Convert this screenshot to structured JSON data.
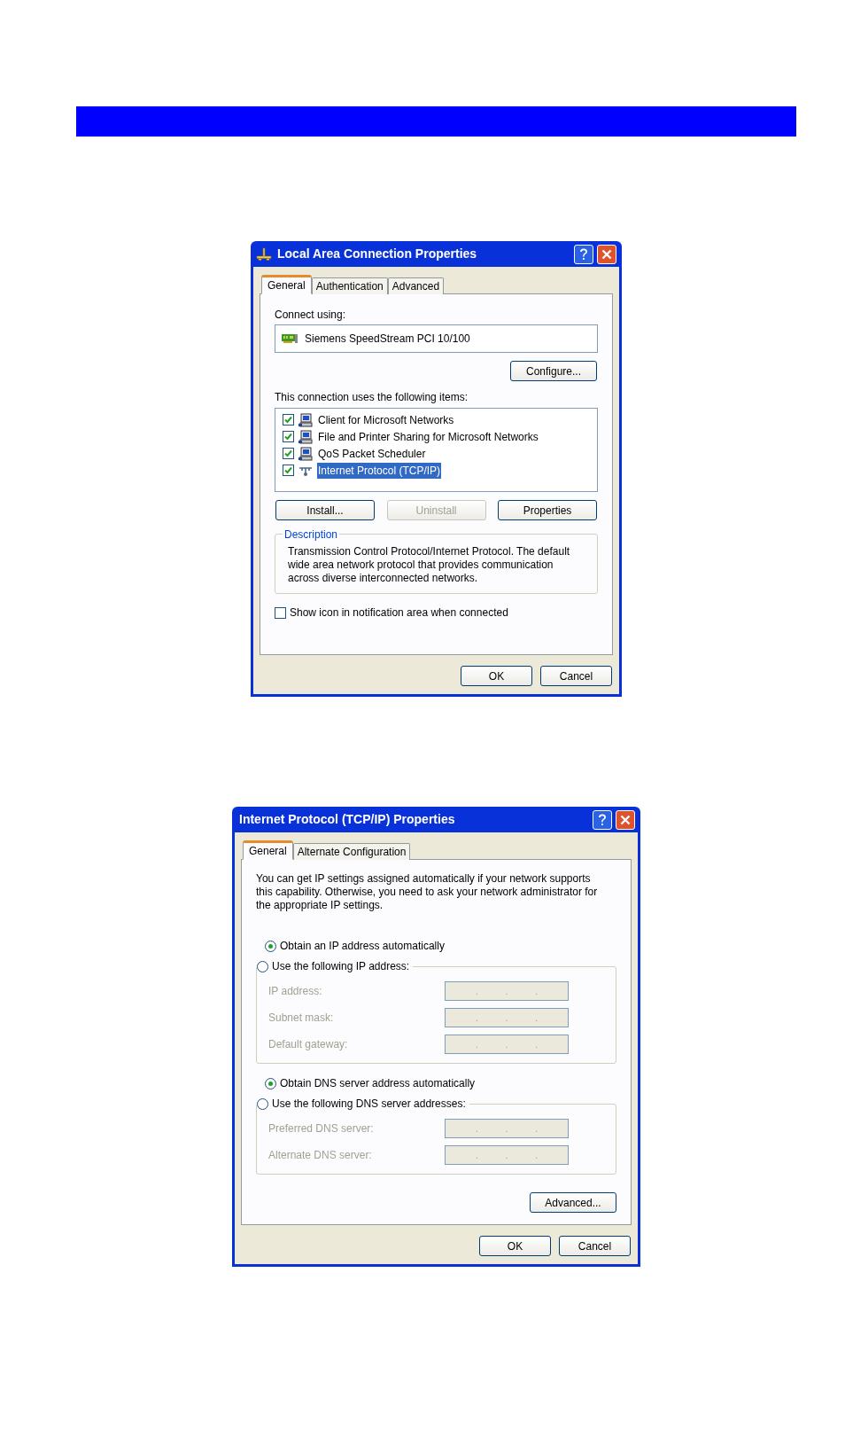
{
  "dialog_1": {
    "title": "Local Area Connection Properties",
    "tabs": [
      {
        "label": "General",
        "selected": true
      },
      {
        "label": "Authentication",
        "selected": false
      },
      {
        "label": "Advanced",
        "selected": false
      }
    ],
    "connect_using_label": "Connect using:",
    "adapter": "Siemens SpeedStream PCI 10/100",
    "configure_button": "Configure...",
    "items_label": "This connection uses the following items:",
    "items": [
      {
        "label": "Client for Microsoft Networks",
        "checked": true,
        "selected": false,
        "kind": "computer"
      },
      {
        "label": "File and Printer Sharing for Microsoft Networks",
        "checked": true,
        "selected": false,
        "kind": "computer"
      },
      {
        "label": "QoS Packet Scheduler",
        "checked": true,
        "selected": false,
        "kind": "computer"
      },
      {
        "label": "Internet Protocol (TCP/IP)",
        "checked": true,
        "selected": true,
        "kind": "protocol"
      }
    ],
    "item_buttons": [
      {
        "label": "Install...",
        "disabled": false
      },
      {
        "label": "Uninstall",
        "disabled": true
      },
      {
        "label": "Properties",
        "disabled": false
      }
    ],
    "description": {
      "legend": "Description",
      "text": "Transmission Control Protocol/Internet Protocol. The default wide area network protocol that provides communication across diverse interconnected networks."
    },
    "show_icon": {
      "label": "Show icon in notification area when connected",
      "checked": false
    },
    "footer_buttons": [
      "OK",
      "Cancel"
    ]
  },
  "dialog_2": {
    "title": "Internet Protocol (TCP/IP) Properties",
    "tabs": [
      {
        "label": "General",
        "selected": true
      },
      {
        "label": "Alternate Configuration",
        "selected": false
      }
    ],
    "intro": "You can get IP settings assigned automatically if your network supports this capability. Otherwise, you need to ask your network administrator for the appropriate IP settings.",
    "ip_options": [
      {
        "label": "Obtain an IP address automatically",
        "selected": true
      },
      {
        "label": "Use the following IP address:",
        "selected": false
      }
    ],
    "ip_fields": [
      {
        "label": "IP address:",
        "value": ". . .",
        "disabled": true
      },
      {
        "label": "Subnet mask:",
        "value": ". . .",
        "disabled": true
      },
      {
        "label": "Default gateway:",
        "value": ". . .",
        "disabled": true
      }
    ],
    "dns_options": [
      {
        "label": "Obtain DNS server address automatically",
        "selected": true
      },
      {
        "label": "Use the following DNS server addresses:",
        "selected": false
      }
    ],
    "dns_fields": [
      {
        "label": "Preferred DNS server:",
        "value": ". . .",
        "disabled": true
      },
      {
        "label": "Alternate DNS server:",
        "value": ". . .",
        "disabled": true
      }
    ],
    "advanced_button": "Advanced...",
    "footer_buttons": [
      "OK",
      "Cancel"
    ]
  }
}
